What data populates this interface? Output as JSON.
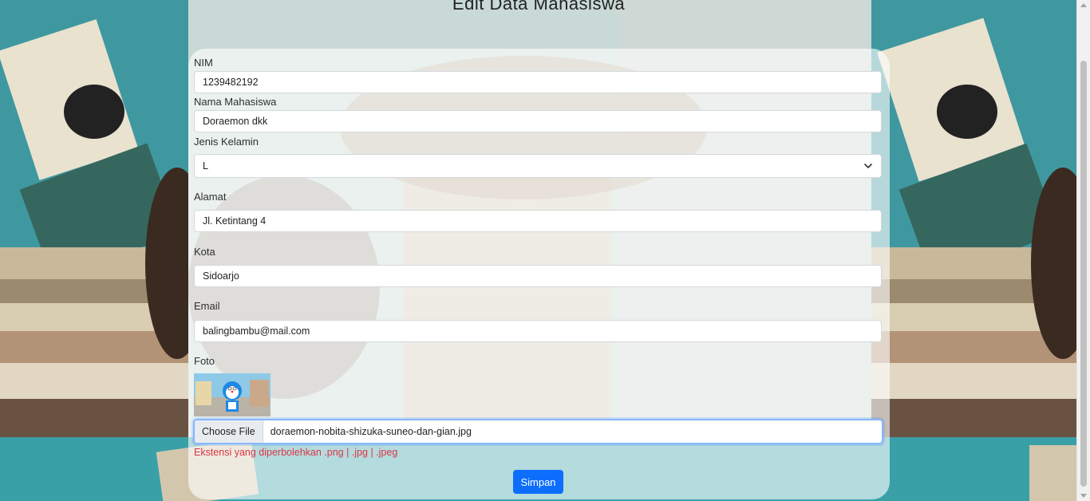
{
  "page": {
    "title": "Edit Data Mahasiswa"
  },
  "form": {
    "nim": {
      "label": "NIM",
      "value": "1239482192"
    },
    "nama": {
      "label": "Nama Mahasiswa",
      "value": "Doraemon dkk"
    },
    "jk": {
      "label": "Jenis Kelamin",
      "selected": "L"
    },
    "alamat": {
      "label": "Alamat",
      "value": "Jl. Ketintang 4"
    },
    "kota": {
      "label": "Kota",
      "value": "Sidoarjo"
    },
    "email": {
      "label": "Email",
      "value": "balingbambu@mail.com"
    },
    "foto": {
      "label": "Foto",
      "choose_label": "Choose File",
      "file_name": "doraemon-nobita-shizuka-suneo-dan-gian.jpg",
      "hint": "Ekstensi yang diperbolehkan .png | .jpg | .jpeg"
    },
    "submit_label": "Simpan"
  },
  "colors": {
    "accent": "#0d6efd",
    "hint": "#dc3545",
    "background": "#3f8f95"
  },
  "icons": {
    "select": "chevron-down-icon"
  }
}
